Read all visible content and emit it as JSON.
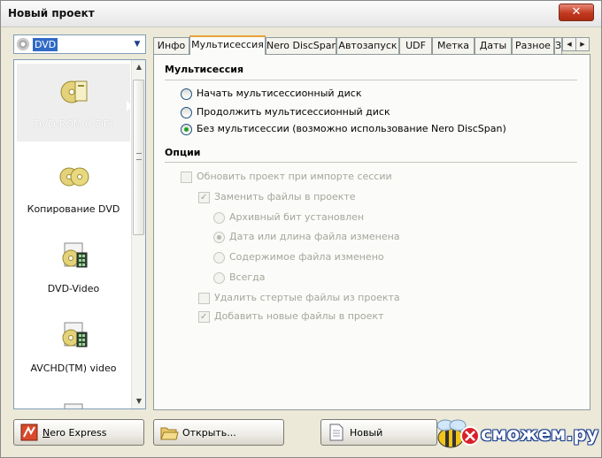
{
  "window": {
    "title": "Новый проект",
    "close_glyph": "✕"
  },
  "project_type": {
    "selected": "DVD",
    "icon": "disc-icon"
  },
  "left_list": {
    "items": [
      {
        "label": "DVD-ROM (UDF)",
        "icon": "dvd-rom-icon",
        "selected": true
      },
      {
        "label": "Копирование DVD",
        "icon": "dvd-copy-icon",
        "selected": false
      },
      {
        "label": "DVD-Video",
        "icon": "dvd-video-icon",
        "selected": false
      },
      {
        "label": "AVCHD(TM) video",
        "icon": "avchd-video-icon",
        "selected": false
      }
    ]
  },
  "tabs": [
    {
      "label": "Инфо",
      "active": false
    },
    {
      "label": "Мультисессия",
      "active": true
    },
    {
      "label": "Nero DiscSpan",
      "active": false
    },
    {
      "label": "Автозапуск",
      "active": false
    },
    {
      "label": "UDF",
      "active": false
    },
    {
      "label": "Метка",
      "active": false
    },
    {
      "label": "Даты",
      "active": false
    },
    {
      "label": "Разное",
      "active": false
    },
    {
      "label": "З",
      "active": false
    }
  ],
  "multisession": {
    "title": "Мультисессия",
    "options": [
      {
        "label": "Начать мультисессионный диск",
        "checked": false
      },
      {
        "label": "Продолжить мультисессионный диск",
        "checked": false
      },
      {
        "label": "Без мультисессии (возможно использование Nero DiscSpan)",
        "checked": true
      }
    ]
  },
  "options_group": {
    "title": "Опции",
    "update_on_import": {
      "label": "Обновить проект при импорте сессии",
      "checked": false,
      "enabled": false
    },
    "replace_files": {
      "label": "Заменить файлы в проекте",
      "checked": true,
      "enabled": false
    },
    "replace_modes": [
      {
        "label": "Архивный бит установлен",
        "checked": false
      },
      {
        "label": "Дата или длина файла изменена",
        "checked": true
      },
      {
        "label": "Содержимое файла изменено",
        "checked": false
      },
      {
        "label": "Всегда",
        "checked": false
      }
    ],
    "remove_deleted": {
      "label": "Удалить стертые файлы из проекта",
      "checked": false,
      "enabled": false
    },
    "add_new": {
      "label": "Добавить новые файлы в проект",
      "checked": true,
      "enabled": false
    }
  },
  "buttons": {
    "nero_express": {
      "label_first": "N",
      "label_rest": "ero Express",
      "icon": "nero-express-icon"
    },
    "open": {
      "label": "Открыть...",
      "icon": "open-folder-icon"
    },
    "new": {
      "label": "Новый",
      "icon": "new-document-icon"
    }
  },
  "watermark": {
    "text": "сможем.ру"
  },
  "colors": {
    "accent_tab": "#e8a33a",
    "selection": "#316ac5",
    "radio_dot": "#21a121",
    "close": "#c0391f"
  }
}
